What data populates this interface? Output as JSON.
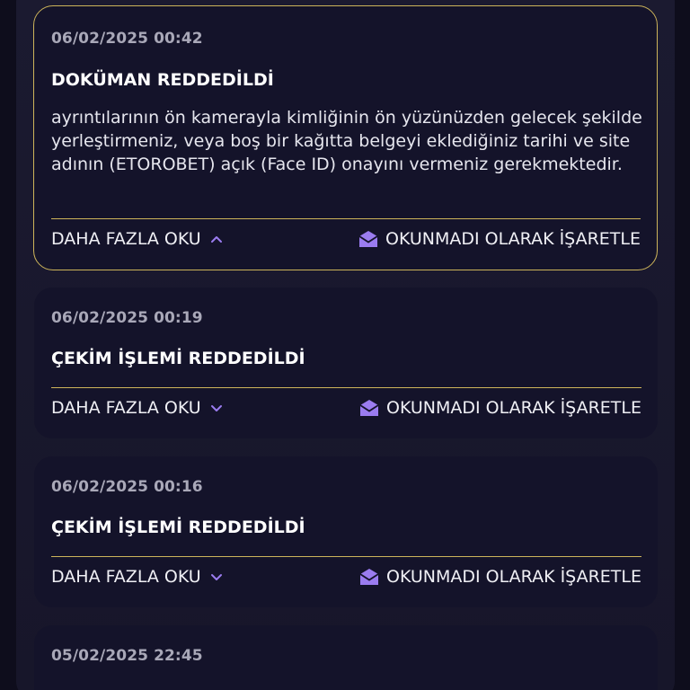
{
  "colors": {
    "accent": "#9b7cf0",
    "border_gold": "#cdb45a",
    "card_bg": "#14132a",
    "page_bg": "#0e0d1c"
  },
  "notifications": [
    {
      "date": "06/02/2025 00:42",
      "title": "DOKÜMAN REDDEDİLDİ",
      "body": "ayrıntılarının ön kamerayla kimliğinin ön yüzünüzden gelecek şekilde yerleştirmeniz, veya boş bir kağıtta belgeyi eklediğiniz tarihi ve site adının (ETOROBET) açık (Face ID) onayını vermeniz gerekmektedir.",
      "read_more": "DAHA FAZLA OKU",
      "read_more_icon": "chevron-up-icon",
      "mark_unread": "OKUNMADI OLARAK İŞARETLE",
      "mark_unread_icon": "open-envelope-icon",
      "expanded": true
    },
    {
      "date": "06/02/2025 00:19",
      "title": "ÇEKİM İŞLEMİ REDDEDİLDİ",
      "read_more": "DAHA FAZLA OKU",
      "read_more_icon": "chevron-down-icon",
      "mark_unread": "OKUNMADI OLARAK İŞARETLE",
      "mark_unread_icon": "open-envelope-icon",
      "expanded": false
    },
    {
      "date": "06/02/2025 00:16",
      "title": "ÇEKİM İŞLEMİ REDDEDİLDİ",
      "read_more": "DAHA FAZLA OKU",
      "read_more_icon": "chevron-down-icon",
      "mark_unread": "OKUNMADI OLARAK İŞARETLE",
      "mark_unread_icon": "open-envelope-icon",
      "expanded": false
    },
    {
      "date": "05/02/2025 22:45",
      "expanded": false
    }
  ]
}
